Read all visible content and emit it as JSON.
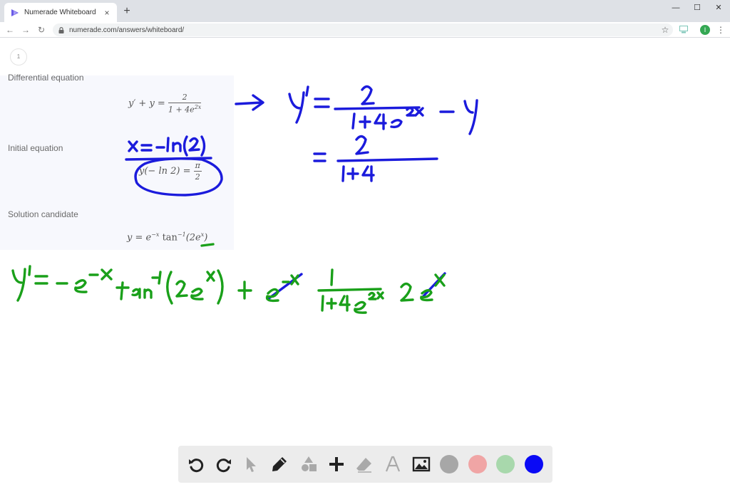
{
  "browser": {
    "tab_title": "Numerade Whiteboard",
    "tab_close": "×",
    "new_tab": "+",
    "url": "numerade.com/answers/whiteboard/",
    "profile_initial": "I",
    "window_minimize": "—",
    "window_maximize": "☐",
    "window_close": "✕"
  },
  "whiteboard": {
    "page_number": "1",
    "panel": {
      "differential_label": "Differential equation",
      "initial_label": "Initial equation",
      "solution_label": "Solution candidate",
      "diff_lhs": "y′ + y =",
      "diff_num": "2",
      "diff_den": "1 + 4e",
      "diff_den_exp": "2x",
      "init_lhs": "y(− ln 2) =",
      "init_num": "π",
      "init_den": "2",
      "sol_text": "y = e",
      "sol_exp": "−x",
      "sol_func": "tan",
      "sol_func_exp": "−1",
      "sol_arg": "(2e",
      "sol_arg_exp": "x",
      "sol_close": ")"
    },
    "ink_colors": {
      "blue": "#1b1bdc",
      "green": "#1aa01a"
    }
  },
  "palette": {
    "icons": [
      "undo-icon",
      "redo-icon",
      "pointer-icon",
      "pen-icon",
      "shapes-icon",
      "plus-icon",
      "eraser-icon",
      "text-icon",
      "image-icon"
    ],
    "colors": [
      "#a7a7a7",
      "#f0a5a5",
      "#a8d8ac",
      "#0a0af5"
    ]
  }
}
